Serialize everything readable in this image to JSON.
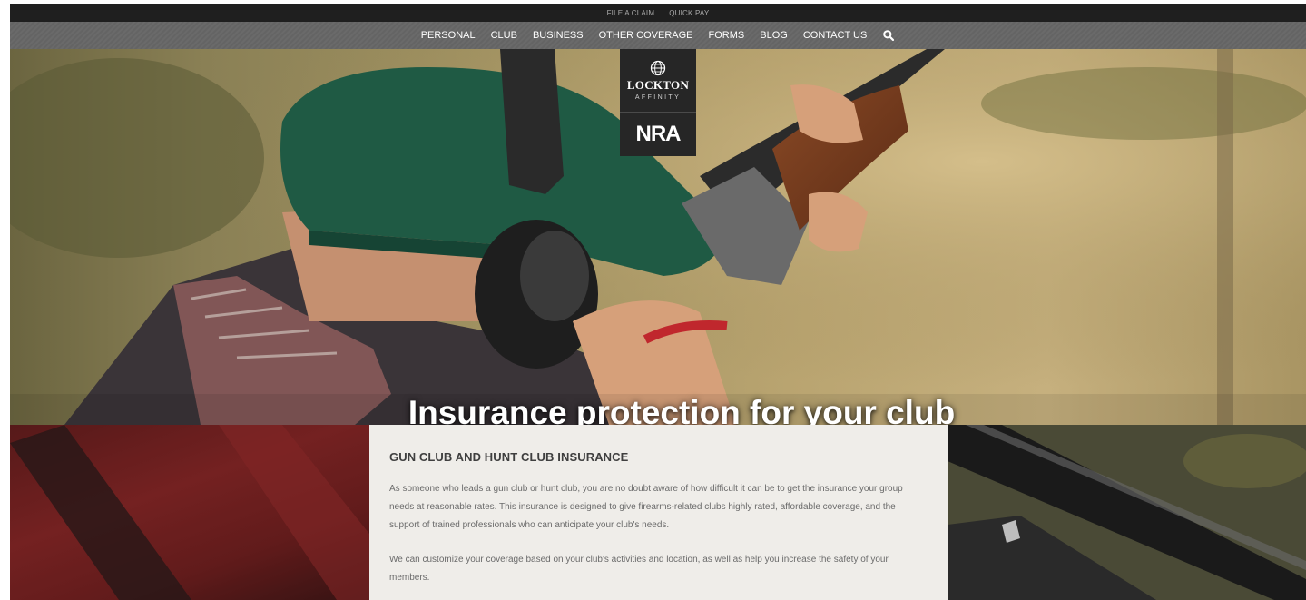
{
  "utility_nav": {
    "file_claim": "FILE A CLAIM",
    "quick_pay": "QUICK PAY"
  },
  "main_nav": {
    "items": [
      "PERSONAL",
      "CLUB",
      "BUSINESS",
      "OTHER COVERAGE",
      "FORMS",
      "BLOG",
      "CONTACT US"
    ],
    "search_icon": "search-icon"
  },
  "logo": {
    "brand": "LOCKTON",
    "sub": "AFFINITY",
    "partner": "NRA"
  },
  "hero": {
    "title": "Insurance protection for your club"
  },
  "content": {
    "heading": "GUN CLUB AND HUNT CLUB INSURANCE",
    "paragraph_1": "As someone who leads a gun club or hunt club, you are no doubt aware of how difficult it can be to get the insurance your group needs at reasonable rates. This insurance is designed to give firearms-related clubs highly rated, affordable coverage, and the support of trained professionals who can anticipate your club's needs.",
    "paragraph_2": "We can customize your coverage based on your club's activities and location, as well as help you increase the safety of your members."
  },
  "colors": {
    "utility_bar": "#1f1f1f",
    "nav_bar": "#666666",
    "logo_box": "#262626",
    "content_panel": "#efede9"
  }
}
